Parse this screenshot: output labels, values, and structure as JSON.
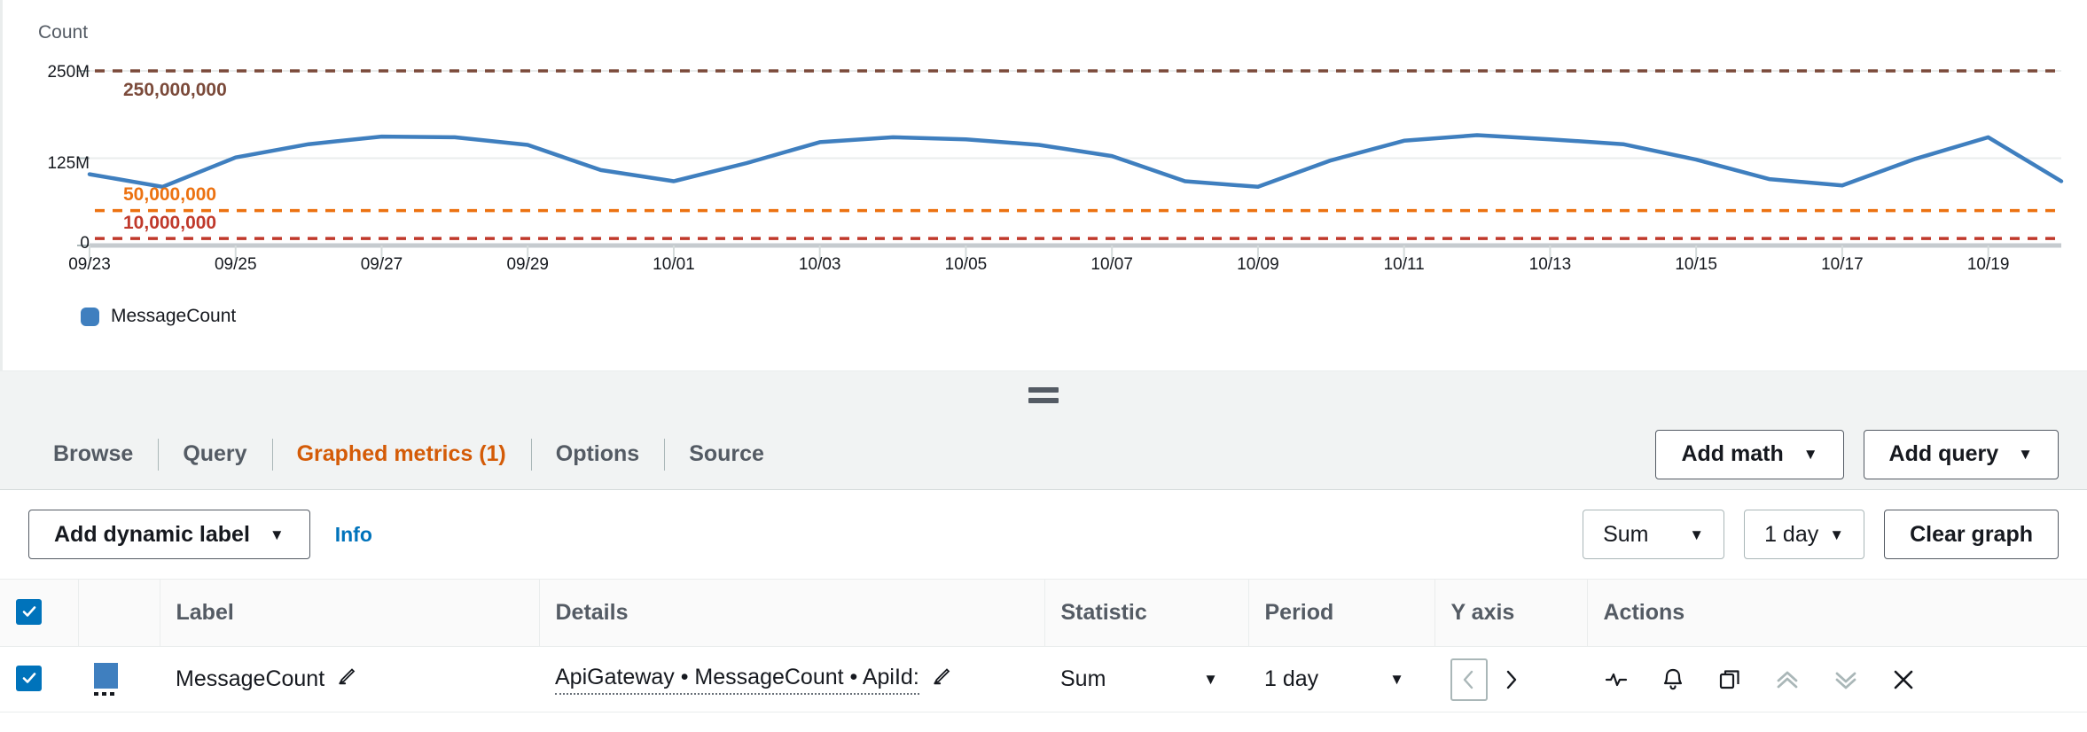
{
  "chart": {
    "axis_title": "Count",
    "legend": [
      {
        "label": "MessageCount",
        "color": "#3f7fbf"
      }
    ]
  },
  "chart_data": {
    "type": "line",
    "title": "",
    "xlabel": "",
    "ylabel": "Count",
    "ylim": [
      0,
      250000000
    ],
    "yticks": [
      "0",
      "125M",
      "250M"
    ],
    "ytick_values": [
      0,
      125000000,
      250000000
    ],
    "grid": true,
    "legend_position": "bottom-left",
    "x": [
      "09/23",
      "09/24",
      "09/25",
      "09/26",
      "09/27",
      "09/28",
      "09/29",
      "09/30",
      "10/01",
      "10/02",
      "10/03",
      "10/04",
      "10/05",
      "10/06",
      "10/07",
      "10/08",
      "10/09",
      "10/10",
      "10/11",
      "10/12",
      "10/13",
      "10/14",
      "10/15",
      "10/16",
      "10/17",
      "10/18",
      "10/19",
      "10/20"
    ],
    "series": [
      {
        "name": "MessageCount",
        "color": "#3f7fbf",
        "values": [
          102000000,
          84000000,
          126000000,
          145000000,
          156000000,
          155000000,
          144000000,
          108000000,
          92000000,
          118000000,
          148000000,
          155000000,
          152000000,
          144000000,
          128000000,
          92000000,
          84000000,
          122000000,
          150000000,
          158000000,
          152000000,
          145000000,
          123000000,
          95000000,
          86000000,
          124000000,
          155000000,
          92000000
        ]
      }
    ],
    "annotations": [
      {
        "name": "horizontal-annotation-250m",
        "label": "250,000,000",
        "value": 250000000,
        "color": "#7b4a3a",
        "style": "dashed"
      },
      {
        "name": "horizontal-annotation-50m",
        "label": "50,000,000",
        "value": 50000000,
        "color": "#ec7211",
        "style": "dashed"
      },
      {
        "name": "horizontal-annotation-10m",
        "label": "10,000,000",
        "value": 10000000,
        "color": "#c0392b",
        "style": "dashed"
      }
    ],
    "xtick_labels": [
      "09/23",
      "09/25",
      "09/27",
      "09/29",
      "10/01",
      "10/03",
      "10/05",
      "10/07",
      "10/09",
      "10/11",
      "10/13",
      "10/15",
      "10/17",
      "10/19"
    ]
  },
  "tabs": [
    {
      "label": "Browse",
      "active": false
    },
    {
      "label": "Query",
      "active": false
    },
    {
      "label": "Graphed metrics (1)",
      "active": true
    },
    {
      "label": "Options",
      "active": false
    },
    {
      "label": "Source",
      "active": false
    }
  ],
  "toolbar": {
    "add_math_label": "Add math",
    "add_query_label": "Add query",
    "caret": "▼"
  },
  "controls": {
    "add_dynamic_label": "Add dynamic label",
    "info_label": "Info",
    "statistic_value": "Sum",
    "period_value": "1 day",
    "clear_graph_label": "Clear graph"
  },
  "table": {
    "headers": [
      "",
      "",
      "Label",
      "Details",
      "Statistic",
      "Period",
      "Y axis",
      "Actions"
    ],
    "rows": [
      {
        "checked": true,
        "color": "#3f7fbf",
        "label": "MessageCount",
        "details": "ApiGateway • MessageCount • ApiId:",
        "statistic": "Sum",
        "period": "1 day"
      }
    ]
  },
  "colors": {
    "accent_orange": "#d45b07",
    "link_blue": "#0073bb",
    "series_blue": "#3f7fbf",
    "panel_grey": "#f1f3f3"
  }
}
